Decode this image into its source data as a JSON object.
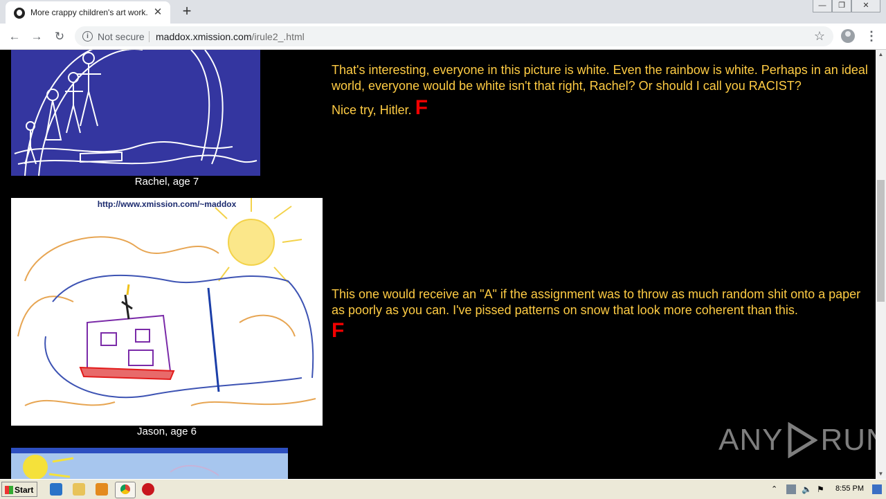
{
  "browser": {
    "tab_title": "More crappy children's art work.",
    "tab_close": "✕",
    "new_tab": "+",
    "security_label": "Not secure",
    "url_host": "maddox.xmission.com",
    "url_path": "/irule2_.html",
    "back": "←",
    "forward": "→",
    "reload": "↻",
    "star": "☆",
    "menu": "⋮",
    "win_min": "—",
    "win_max": "❐",
    "win_close": "✕"
  },
  "entries": [
    {
      "caption": "Rachel, age 7",
      "comment": "That's interesting, everyone in this picture is white. Even the rainbow is white. Perhaps in an ideal world, everyone would be white isn't that right, Rachel? Or should I call you RACIST?",
      "comment2": "Nice try, Hitler.",
      "grade": "F"
    },
    {
      "caption": "Jason, age 6",
      "image_text": "http://www.xmission.com/~maddox",
      "comment": "This one would receive an \"A\" if the assignment was to throw as much random shit onto a paper as poorly as you can. I've pissed patterns on snow that look more coherent than this.",
      "grade": "F"
    }
  ],
  "watermark": {
    "left": "ANY",
    "right": "RUN"
  },
  "taskbar": {
    "start": "Start",
    "clock": "8:55 PM"
  },
  "colors": {
    "comment_text": "#ffcc44",
    "grade": "#f20000",
    "page_bg": "#000000"
  }
}
